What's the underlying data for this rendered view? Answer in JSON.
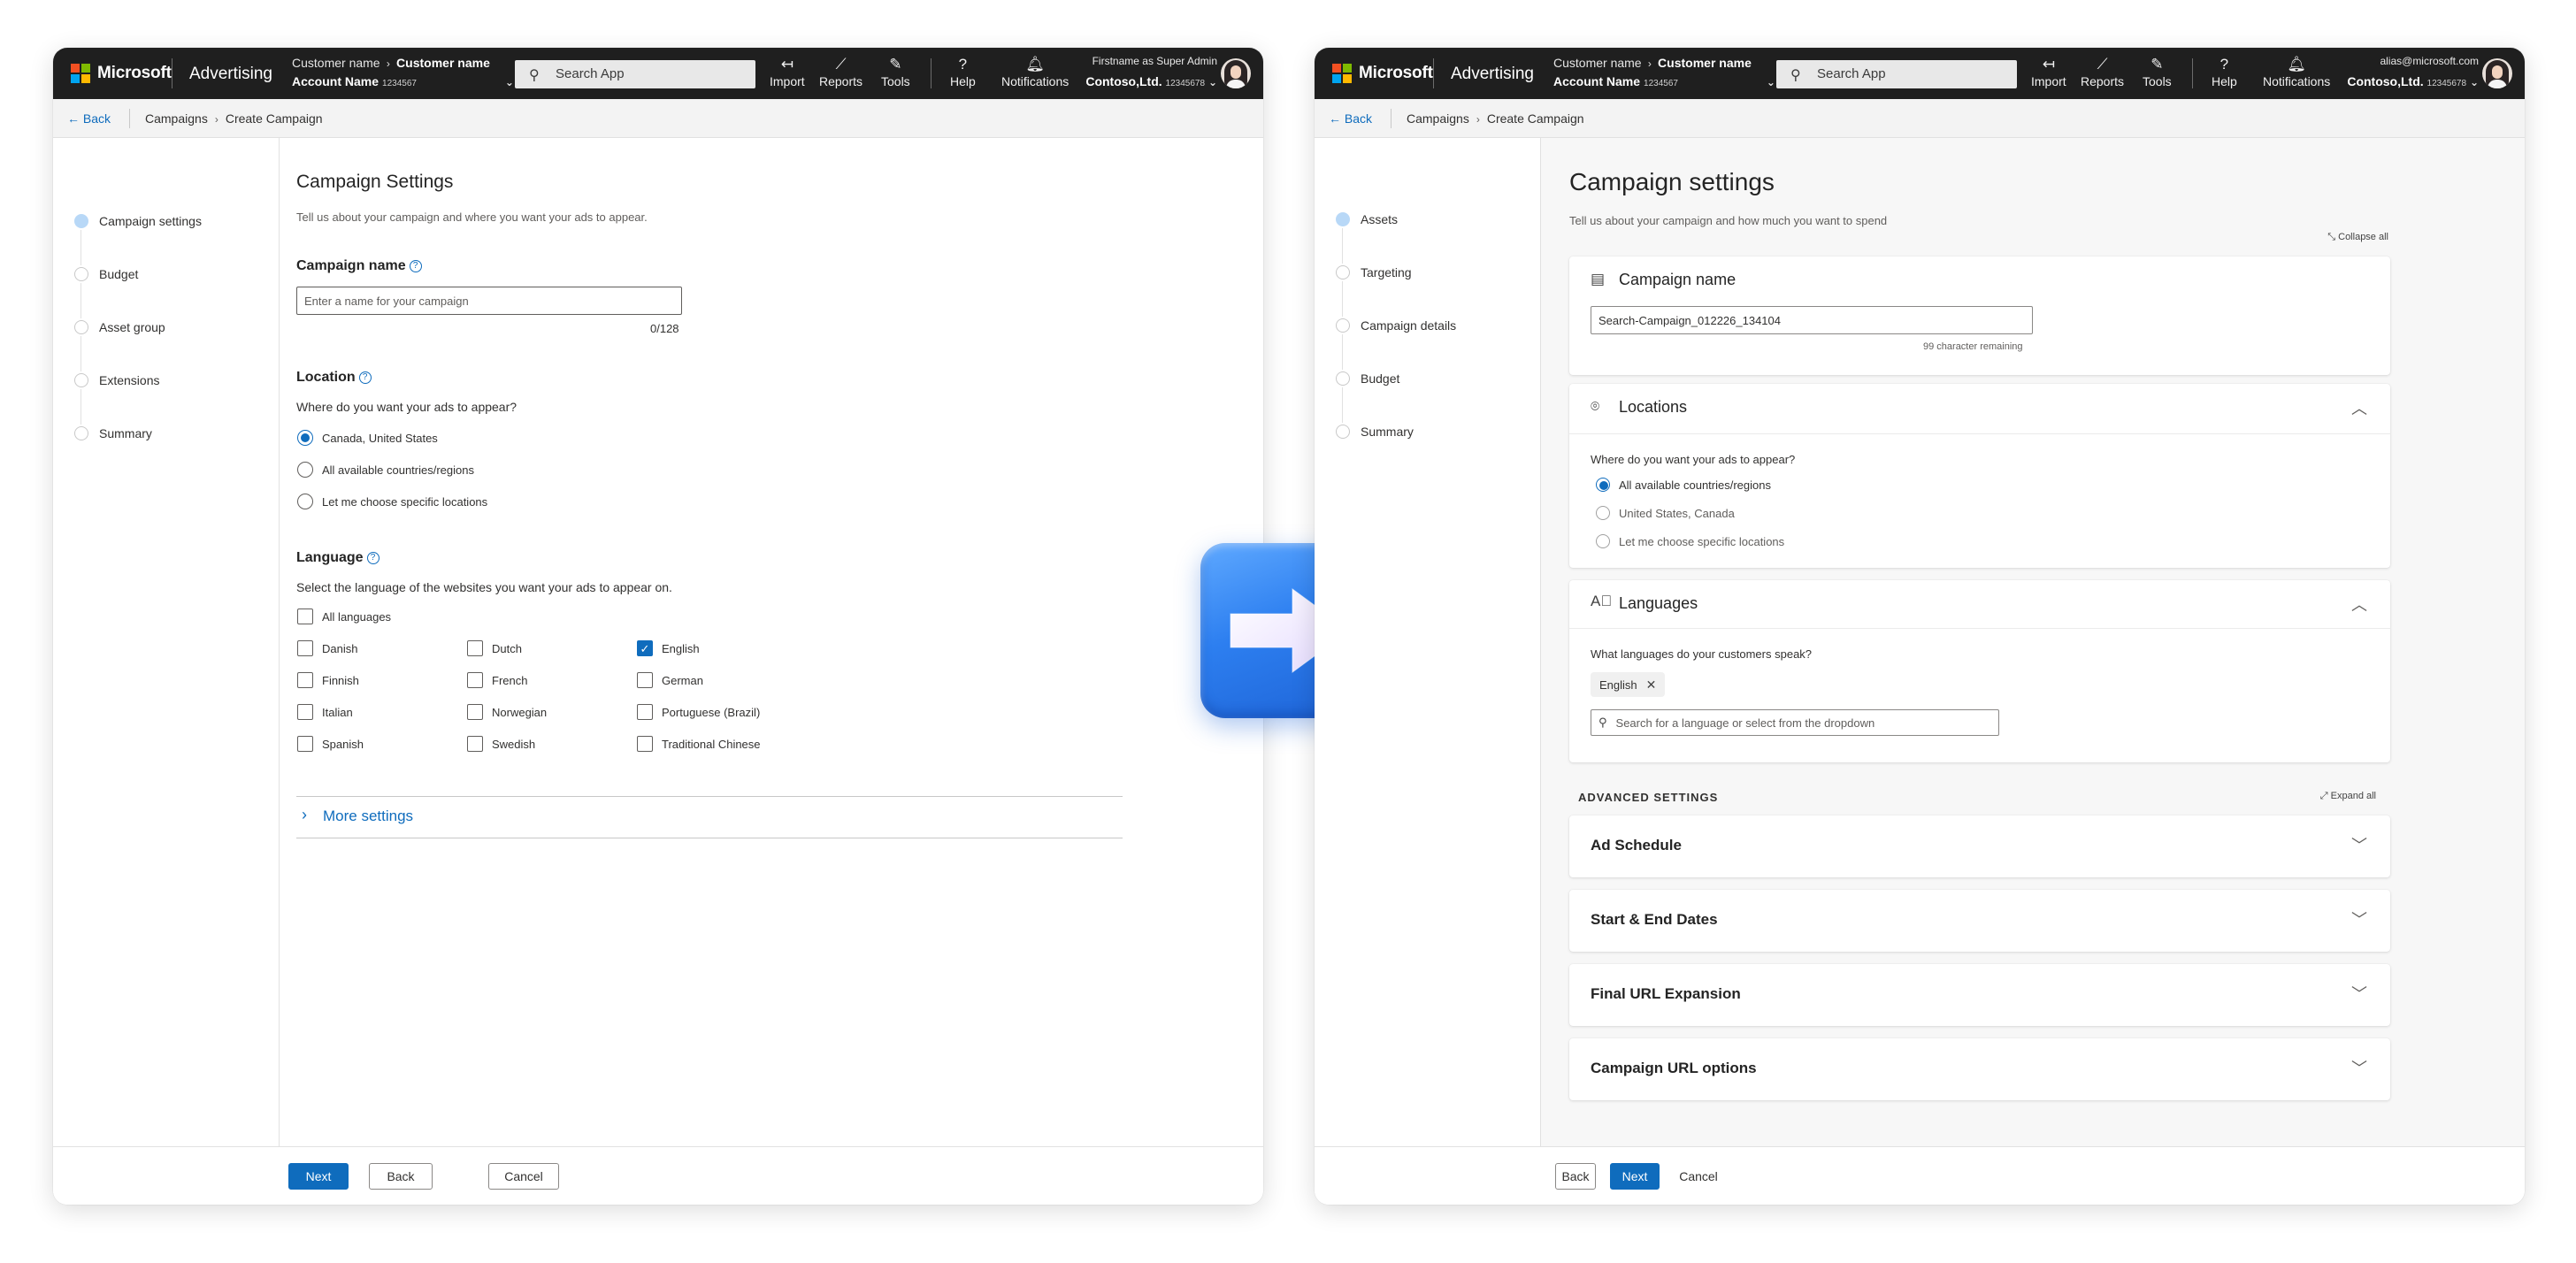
{
  "colors": {
    "accent": "#0f6cbd",
    "topbar": "#1f1f1f",
    "arrow": "#2d7ff0"
  },
  "topbar_left": {
    "brand": "Microsoft",
    "product": "Advertising",
    "customer_label": "Customer name",
    "customer_value": "Customer name",
    "account_label": "Account Name",
    "account_number": "1234567",
    "search_placeholder": "Search App",
    "tools": [
      "Import",
      "Reports",
      "Tools",
      "Help",
      "Notifications"
    ],
    "user_line1": "Firstname as Super Admin",
    "user_company": "Contoso,Ltd.",
    "user_number": "12345678"
  },
  "topbar_right": {
    "brand": "Microsoft",
    "product": "Advertising",
    "customer_label": "Customer name",
    "customer_value": "Customer name",
    "account_label": "Account Name",
    "account_number": "1234567",
    "search_placeholder": "Search App",
    "tools": [
      "Import",
      "Reports",
      "Tools",
      "Help",
      "Notifications"
    ],
    "user_line1": "alias@microsoft.com",
    "user_company": "Contoso,Ltd.",
    "user_number": "12345678"
  },
  "breadcrumb": {
    "back": "Back",
    "campaigns": "Campaigns",
    "current": "Create Campaign"
  },
  "left": {
    "steps": [
      "Campaign settings",
      "Budget",
      "Asset group",
      "Extensions",
      "Summary"
    ],
    "title": "Campaign Settings",
    "description": "Tell us about your campaign and where you want your ads to appear.",
    "campaign_name_label": "Campaign name",
    "campaign_name_placeholder": "Enter a name for your campaign",
    "campaign_name_counter": "0/128",
    "location_label": "Location",
    "location_question": "Where do you want your ads to appear?",
    "location_options": [
      "Canada, United States",
      "All available countries/regions",
      "Let me choose specific locations"
    ],
    "location_selected": 0,
    "language_label": "Language",
    "language_question": "Select the language of the websites you want your ads to appear on.",
    "all_languages": "All languages",
    "languages": [
      [
        "Danish",
        "Dutch",
        "English"
      ],
      [
        "Finnish",
        "French",
        "German"
      ],
      [
        "Italian",
        "Norwegian",
        "Portuguese (Brazil)"
      ],
      [
        "Spanish",
        "Swedish",
        "Traditional Chinese"
      ]
    ],
    "languages_checked": [
      "English"
    ],
    "more_settings": "More settings",
    "buttons": {
      "next": "Next",
      "back": "Back",
      "cancel": "Cancel"
    }
  },
  "right": {
    "steps": [
      "Assets",
      "Targeting",
      "Campaign details",
      "Budget",
      "Summary"
    ],
    "title": "Campaign settings",
    "description": "Tell us about your campaign and how much you want to spend",
    "collapse_all": "Collapse all",
    "campaign_name_title": "Campaign name",
    "campaign_name_value": "Search-Campaign_012226_134104",
    "campaign_name_remaining": "99 character remaining",
    "locations_title": "Locations",
    "locations_question": "Where do you want your ads to appear?",
    "location_options": [
      "All available countries/regions",
      "United States, Canada",
      "Let me choose specific locations"
    ],
    "location_selected": 0,
    "languages_title": "Languages",
    "languages_question": "What languages do your customers speak?",
    "language_chip": "English",
    "language_search_placeholder": "Search for a language or select from the dropdown",
    "advanced_title": "ADVANCED SETTINGS",
    "expand_all": "Expand all",
    "advanced_items": [
      "Ad Schedule",
      "Start & End Dates",
      "Final URL Expansion",
      "Campaign URL options"
    ],
    "buttons": {
      "back": "Back",
      "next": "Next",
      "cancel": "Cancel"
    }
  }
}
